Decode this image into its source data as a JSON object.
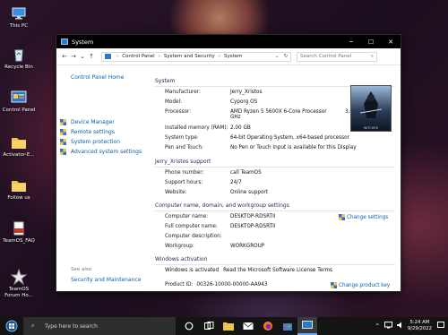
{
  "desktop": {
    "icons": [
      {
        "label": "This PC"
      },
      {
        "label": "Recycle Bin"
      },
      {
        "label": "Control Panel"
      },
      {
        "label": "Activator-E..."
      },
      {
        "label": "Follow us"
      },
      {
        "label": "TeamOS_FAQ"
      },
      {
        "label": "TeamOS Forum Ho..."
      }
    ]
  },
  "window": {
    "title": "System",
    "controls": {
      "minimize": "─",
      "maximize": "☐",
      "close": "✕"
    },
    "address": {
      "crumbs": [
        "Control Panel",
        "System and Security",
        "System"
      ],
      "search_placeholder": "Search Control Panel"
    }
  },
  "left_pane": {
    "home": "Control Panel Home",
    "links": [
      "Device Manager",
      "Remote settings",
      "System protection",
      "Advanced system settings"
    ],
    "see_also": "See also",
    "security_maintenance": "Security and Maintenance"
  },
  "system": {
    "header": "System",
    "rows": [
      {
        "key": "Manufacturer:",
        "value": "Jerry_Xristos"
      },
      {
        "key": "Model:",
        "value": "Cyporg OS"
      },
      {
        "key": "Processor:",
        "value": "AMD Ryzen 5 5600X 6-Core Processor",
        "value2": "3.69",
        "value3": "GHz"
      },
      {
        "key": "Installed memory (RAM):",
        "value": "2.00 GB"
      },
      {
        "key": "System type:",
        "value": "64-bit Operating System, x64-based processor"
      },
      {
        "key": "Pen and Touch:",
        "value": "No Pen or Touch Input is available for this Display"
      }
    ],
    "logo_caption": "WITCHER"
  },
  "support": {
    "header": "Jerry_Xristos support",
    "rows": [
      {
        "key": "Phone number:",
        "value": "call TeamOS"
      },
      {
        "key": "Support hours:",
        "value": "24/7"
      },
      {
        "key": "Website:",
        "value": "Online support"
      }
    ]
  },
  "computer_name": {
    "header": "Computer name, domain, and workgroup settings",
    "rows": [
      {
        "key": "Computer name:",
        "value": "DESKTOP-RDSRTII"
      },
      {
        "key": "Full computer name:",
        "value": "DESKTOP-RDSRTII"
      },
      {
        "key": "Computer description:",
        "value": ""
      },
      {
        "key": "Workgroup:",
        "value": "WORKGROUP"
      }
    ],
    "change_settings": "Change settings"
  },
  "activation": {
    "header": "Windows activation",
    "status": "Windows is activated",
    "license_link": "Read the Microsoft Software License Terms",
    "product_id_label": "Product ID:",
    "product_id": "00326-10000-00000-AA943",
    "change_key": "Change product key"
  },
  "taskbar": {
    "search_placeholder": "Type here to search",
    "time": "5:24 AM",
    "date": "9/29/2022"
  },
  "colors": {
    "link": "#0b5ea8",
    "titlebar": "#000000",
    "taskbar": "#141414"
  }
}
